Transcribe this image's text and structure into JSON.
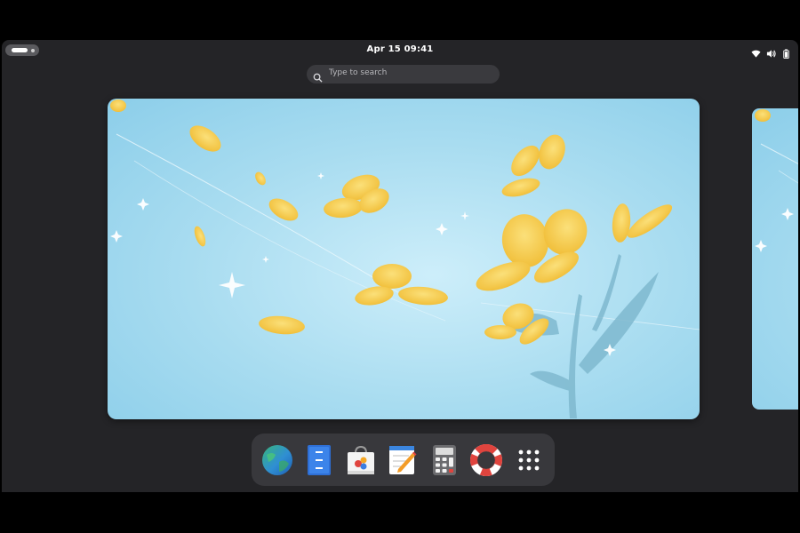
{
  "topbar": {
    "activities_icon": "activities-pill-icon",
    "clock": "Apr 15  09:41",
    "status_icons": [
      "wifi-icon",
      "volume-icon",
      "battery-icon"
    ]
  },
  "search": {
    "placeholder": "Type to search",
    "icon": "search-icon"
  },
  "workspaces": [
    {
      "name": "workspace-1",
      "state": "active"
    },
    {
      "name": "workspace-2",
      "state": "partially-visible"
    }
  ],
  "dock": {
    "apps": [
      {
        "name": "web-browser",
        "icon": "globe-icon"
      },
      {
        "name": "files",
        "icon": "file-cabinet-icon"
      },
      {
        "name": "software",
        "icon": "shopping-bag-icon"
      },
      {
        "name": "text-editor",
        "icon": "notepad-pencil-icon"
      },
      {
        "name": "calculator",
        "icon": "calculator-icon"
      },
      {
        "name": "help",
        "icon": "lifebuoy-icon"
      },
      {
        "name": "show-apps",
        "icon": "app-grid-icon"
      }
    ]
  },
  "colors": {
    "panel_bg": "#242427",
    "dock_bg": "#38383c",
    "wallpaper_sky": "#a9dcef",
    "flower": "#f7c944"
  }
}
